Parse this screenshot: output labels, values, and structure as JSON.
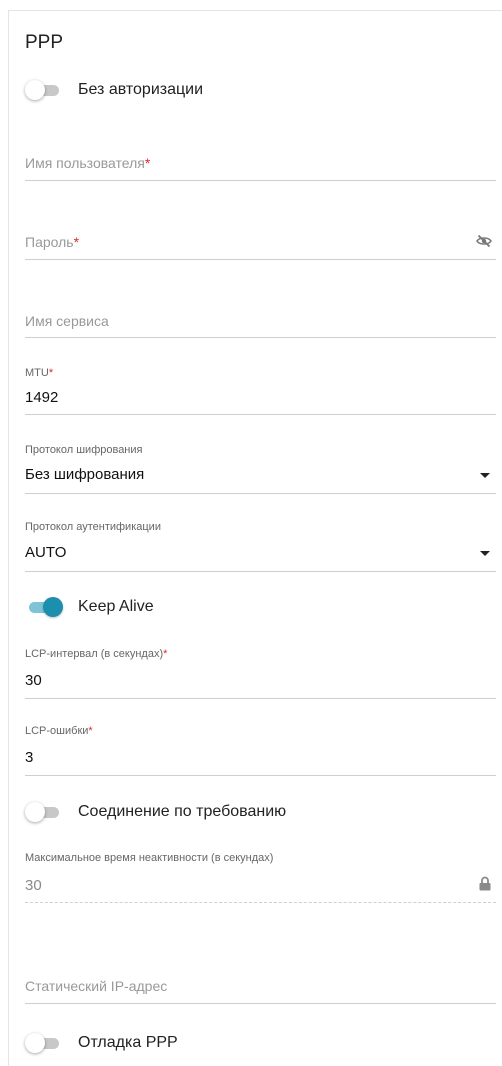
{
  "section_title": "PPP",
  "no_auth": {
    "label": "Без авторизации",
    "enabled": false
  },
  "username": {
    "placeholder": "Имя пользователя",
    "required_mark": "*",
    "value": ""
  },
  "password": {
    "placeholder": "Пароль",
    "required_mark": "*",
    "value": "",
    "icon": "eye-off-icon"
  },
  "service_name": {
    "placeholder": "Имя сервиса",
    "value": ""
  },
  "mtu": {
    "label": "MTU",
    "required_mark": "*",
    "value": "1492"
  },
  "encryption": {
    "label": "Протокол шифрования",
    "selected": "Без шифрования",
    "icon": "chevron-down-icon"
  },
  "auth_protocol": {
    "label": "Протокол аутентификации",
    "selected": "AUTO",
    "icon": "chevron-down-icon"
  },
  "keep_alive": {
    "label": "Keep Alive",
    "enabled": true,
    "accent": "#1b8fad"
  },
  "lcp_interval": {
    "label": "LCP-интервал (в секундах)",
    "required_mark": "*",
    "value": "30"
  },
  "lcp_failures": {
    "label": "LCP-ошибки",
    "required_mark": "*",
    "value": "3"
  },
  "dial_on_demand": {
    "label": "Соединение по требованию",
    "enabled": false
  },
  "max_idle": {
    "label": "Максимальное время неактивности (в секундах)",
    "value": "30",
    "icon": "lock-icon"
  },
  "static_ip": {
    "placeholder": "Статический IP-адрес",
    "value": ""
  },
  "ppp_debug": {
    "label": "Отладка PPP",
    "enabled": false
  },
  "colors": {
    "required": "#e0262b",
    "accent": "#1b8fad"
  }
}
